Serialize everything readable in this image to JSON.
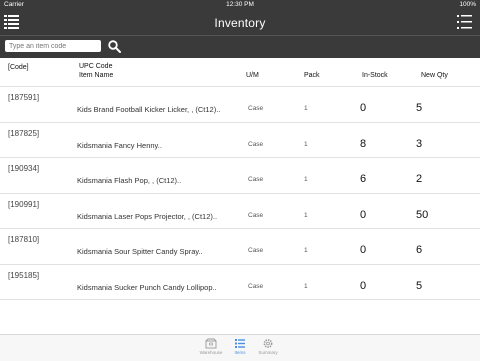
{
  "status_bar": {
    "carrier": "Carrier",
    "time": "12:30 PM",
    "battery": "100%"
  },
  "nav": {
    "title": "Inventory",
    "left_icon": "list-menu-icon",
    "right_icon": "list-detail-icon"
  },
  "search": {
    "placeholder": "Type an item code",
    "icon": "search-icon"
  },
  "columns": {
    "code": "[Code]",
    "upc": "UPC Code",
    "item_name": "Item Name",
    "um": "U/M",
    "pack": "Pack",
    "in_stock": "In-Stock",
    "new_qty": "New Qty"
  },
  "rows": [
    {
      "code": "[187591]",
      "name": "Kids Brand Football Kicker Licker, , (Ct12)..",
      "um": "Case",
      "pack": "1",
      "in_stock": "0",
      "new_qty": "5"
    },
    {
      "code": "[187825]",
      "name": "Kidsmania Fancy Henny..",
      "um": "Case",
      "pack": "1",
      "in_stock": "8",
      "new_qty": "3"
    },
    {
      "code": "[190934]",
      "name": "Kidsmania Flash Pop, , (Ct12)..",
      "um": "Case",
      "pack": "1",
      "in_stock": "6",
      "new_qty": "2"
    },
    {
      "code": "[190991]",
      "name": "Kidsmania Laser Pops Projector, , (Ct12)..",
      "um": "Case",
      "pack": "1",
      "in_stock": "0",
      "new_qty": "50"
    },
    {
      "code": "[187810]",
      "name": "Kidsmania Sour Spitter Candy Spray..",
      "um": "Case",
      "pack": "1",
      "in_stock": "0",
      "new_qty": "6"
    },
    {
      "code": "[195185]",
      "name": "Kidsmania Sucker Punch Candy Lollipop..",
      "um": "Case",
      "pack": "1",
      "in_stock": "0",
      "new_qty": "5"
    }
  ],
  "tabs": [
    {
      "label": "Warehouse",
      "icon": "warehouse-icon",
      "active": false
    },
    {
      "label": "Items",
      "icon": "items-list-icon",
      "active": true
    },
    {
      "label": "Summary",
      "icon": "gear-icon",
      "active": false
    }
  ],
  "colors": {
    "bar": "#3a3a3a",
    "accent": "#4a90e2"
  }
}
